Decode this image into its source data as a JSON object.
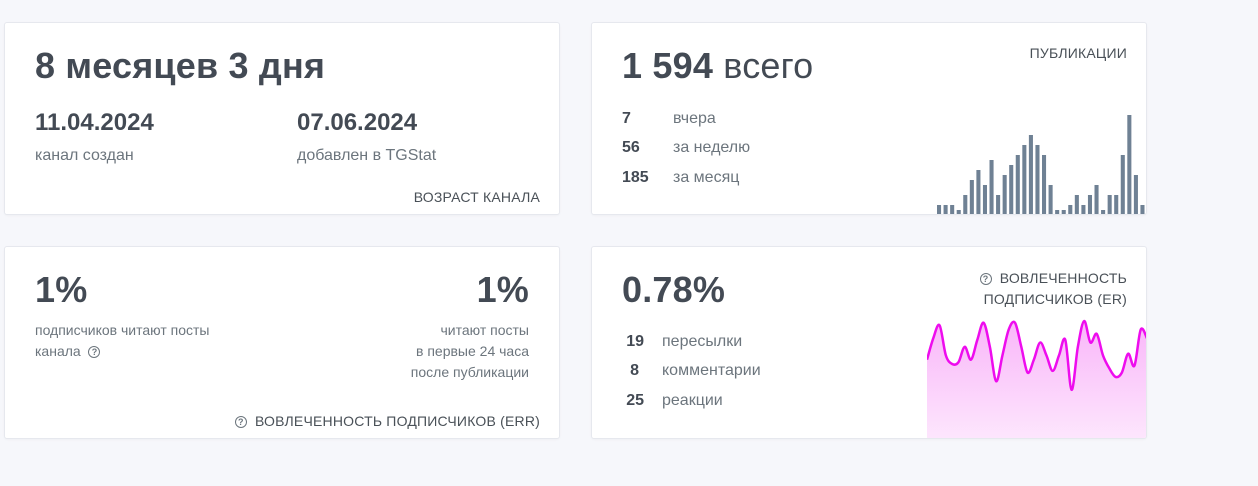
{
  "age_card": {
    "title": "8 месяцев 3 дня",
    "created_date": "11.04.2024",
    "created_label": "канал создан",
    "added_date": "07.06.2024",
    "added_label": "добавлен в TGStat",
    "caption": "ВОЗРАСТ КАНАЛА"
  },
  "pubs_card": {
    "total_value": "1 594",
    "total_word": "всего",
    "caption": "ПУБЛИКАЦИИ",
    "stats": [
      {
        "value": "7",
        "label": "вчера"
      },
      {
        "value": "56",
        "label": "за неделю"
      },
      {
        "value": "185",
        "label": "за месяц"
      }
    ],
    "bar_color": "#6f8194",
    "bars": [
      1,
      1,
      1,
      0.5,
      2,
      3.5,
      4.5,
      3,
      5.5,
      2,
      4,
      5,
      6,
      7,
      8,
      7,
      6,
      3,
      0.5,
      0.5,
      1,
      2,
      1,
      2,
      3,
      0.5,
      2,
      2,
      6,
      10,
      4,
      1
    ]
  },
  "err_card": {
    "left_value": "1%",
    "left_note_line1": "подписчиков читают посты",
    "left_note_line2": "канала",
    "right_value": "1%",
    "right_note_line1": "читают посты",
    "right_note_line2": "в первые 24 часа",
    "right_note_line3": "после публикации",
    "caption": "ВОВЛЕЧЕННОСТЬ ПОДПИСЧИКОВ (ERR)",
    "help_icon": "question-circle-icon"
  },
  "er_card": {
    "value": "0.78%",
    "caption_line1": "ВОВЛЕЧЕННОСТЬ",
    "caption_line2": "ПОДПИСЧИКОВ (ER)",
    "help_icon": "question-circle-icon",
    "stats": [
      {
        "value": "19",
        "label": "пересылки"
      },
      {
        "value": "8",
        "label": "комментарии"
      },
      {
        "value": "25",
        "label": "реакции"
      }
    ],
    "line_color": "#ee0cee",
    "fill_color": "#f9b6f9",
    "sparkline": [
      0.55,
      0.8,
      0.95,
      0.6,
      0.5,
      0.52,
      0.7,
      0.55,
      0.78,
      0.98,
      0.7,
      0.3,
      0.6,
      0.9,
      0.98,
      0.7,
      0.4,
      0.55,
      0.75,
      0.6,
      0.42,
      0.6,
      0.78,
      0.2,
      0.7,
      1.0,
      0.75,
      0.85,
      0.6,
      0.45,
      0.35,
      0.4,
      0.62,
      0.48,
      0.9,
      0.8
    ]
  }
}
